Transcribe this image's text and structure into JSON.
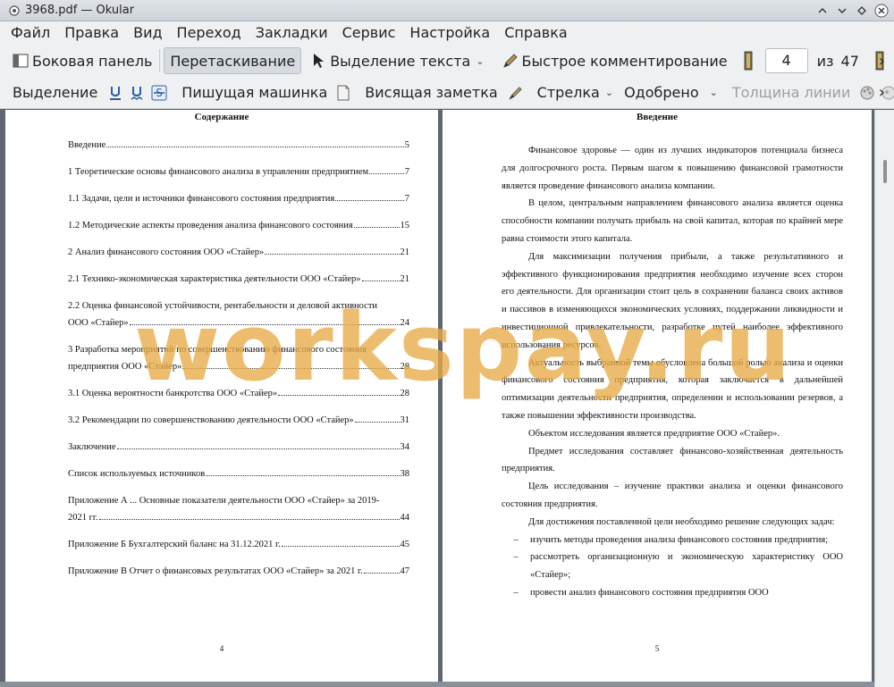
{
  "window": {
    "title": "3968.pdf  — Okular"
  },
  "menu": [
    "Файл",
    "Правка",
    "Вид",
    "Переход",
    "Закладки",
    "Сервис",
    "Настройка",
    "Справка"
  ],
  "toolbar1": {
    "sidebar": "Боковая панель",
    "drag": "Перетаскивание",
    "text_select": "Выделение текста",
    "quick_comment": "Быстрое комментирование",
    "page_current": "4",
    "page_of": "из",
    "page_total": "47",
    "overflow": "›"
  },
  "toolbar2": {
    "highlight": "Выделение",
    "typewriter": "Пишущая машинка",
    "note": "Висящая заметка",
    "arrow": "Стрелка",
    "stamp": "Одобрено",
    "line_width": "Толщина линии",
    "overflow": "›"
  },
  "left_page": {
    "heading": "Содержание",
    "number": "4",
    "toc": [
      {
        "lines": [
          "Введение"
        ],
        "page": "5"
      },
      {
        "lines": [
          "1 Теоретические основы финансового анализа в управлении предприятием"
        ],
        "page": "7"
      },
      {
        "lines": [
          "1.1 Задачи, цели и источники финансового состояния предприятия"
        ],
        "page": "7"
      },
      {
        "lines": [
          "1.2 Методические аспекты проведения анализа финансового состояния"
        ],
        "page": "15"
      },
      {
        "lines": [
          "2 Анализ финансового состояния ООО «Стайер»"
        ],
        "page": "21"
      },
      {
        "lines": [
          "2.1 Технико-экономическая характеристика деятельности ООО «Стайер»"
        ],
        "page": "21"
      },
      {
        "lines": [
          "2.2 Оценка финансовой устойчивости, рентабельности и деловой активности",
          "ООО «Стайер»"
        ],
        "page": "24"
      },
      {
        "lines": [
          "3 Разработка мероприятий по совершенствованию финансового состояния",
          "предприятия ООО «Стайер»"
        ],
        "page": "28"
      },
      {
        "lines": [
          "3.1 Оценка вероятности банкротства ООО «Стайер»"
        ],
        "page": "28"
      },
      {
        "lines": [
          "3.2 Рекомендации по совершенствованию деятельности ООО «Стайер»"
        ],
        "page": "31"
      },
      {
        "lines": [
          "Заключение"
        ],
        "page": "34"
      },
      {
        "lines": [
          "Список используемых источников"
        ],
        "page": "38"
      },
      {
        "lines": [
          "Приложение А ...  Основные показатели деятельности ООО «Стайер» за 2019-",
          "2021 гг."
        ],
        "page": "44"
      },
      {
        "lines": [
          "Приложение Б Бухгалтерский баланс на 31.12.2021 г."
        ],
        "page": "45"
      },
      {
        "lines": [
          "Приложение В Отчет о финансовых результатах ООО «Стайер» за 2021 г."
        ],
        "page": "47"
      }
    ]
  },
  "right_page": {
    "heading": "Введение",
    "number": "5",
    "paragraphs": [
      "Финансовое здоровье — один из лучших индикаторов потенциала бизнеса для долгосрочного роста. Первым шагом к повышению финансовой грамотности является проведение финансового анализа компании.",
      "В целом, центральным направлением финансового анализа является оценка способности компании получать прибыль на свой капитал, которая по крайней мере равна стоимости этого капитала.",
      "Для максимизации получения прибыли, а также результативного и эффективного функционирования предприятия необходимо изучение всех сторон его деятельности. Для организации стоит цель в сохранении баланса своих активов и пассивов в изменяющихся экономических условиях, поддержании ликвидности и инвестиционной привлекательности, разработке путей наиболее эффективного использования ресурсов.",
      "Актуальность выбранной темы обусловлена большой ролью анализа и оценки финансового состояния предприятия, которая заключается в дальнейшей оптимизации деятельности предприятия, определении и использовании резервов, а также повышении эффективности производства.",
      "Объектом исследования является предприятие ООО «Стайер».",
      "Предмет исследования составляет финансово-хозяйственная деятельность предприятия.",
      "Цель исследования – изучение практики анализа и оценки финансового состояния предприятия.",
      "Для достижения поставленной цели необходимо решение следующих задач:"
    ],
    "list_dash": "–",
    "list": [
      "изучить методы проведения анализа финансового состояния предприятия;",
      "рассмотреть организационную и экономическую характеристику ООО «Стайер»;",
      "провести анализ финансового состояния предприятия ООО"
    ]
  },
  "watermark": "workspay.ru"
}
